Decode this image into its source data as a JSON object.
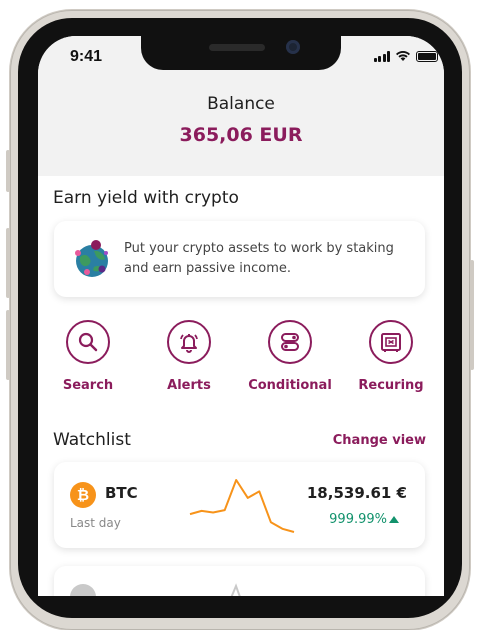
{
  "status_bar": {
    "time": "9:41",
    "icons": [
      "signal-icon",
      "wifi-icon",
      "battery-icon"
    ]
  },
  "balance": {
    "label": "Balance",
    "value": "365,06 EUR"
  },
  "earn": {
    "title": "Earn yield with crypto",
    "description": "Put your crypto assets to work by staking and earn passive income.",
    "icon": "globe-icon"
  },
  "actions": [
    {
      "label": "Search",
      "icon": "search-icon"
    },
    {
      "label": "Alerts",
      "icon": "bell-icon"
    },
    {
      "label": "Conditional",
      "icon": "toggle-icon"
    },
    {
      "label": "Recurring",
      "display": "Recuring",
      "icon": "safe-icon"
    }
  ],
  "watchlist": {
    "title": "Watchlist",
    "change_view": "Change view",
    "items": [
      {
        "symbol": "BTC",
        "icon": "bitcoin-icon",
        "icon_glyph": "₿",
        "period": "Last day",
        "price": "18,539.61 €",
        "change": "999.99%",
        "trend": "up",
        "sparkline": [
          30,
          34,
          32,
          35,
          72,
          50,
          58,
          20,
          12,
          8
        ]
      }
    ]
  },
  "colors": {
    "accent": "#8b1c5c",
    "positive": "#12926c",
    "btc": "#f7931a"
  }
}
